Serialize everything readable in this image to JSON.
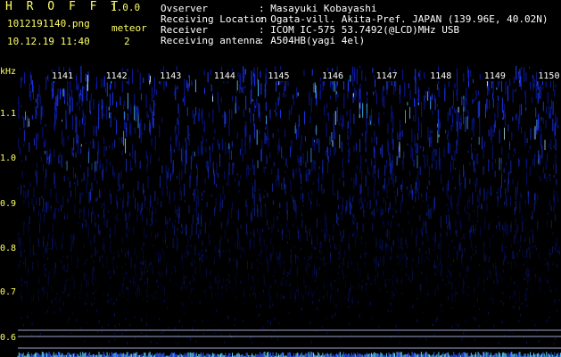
{
  "app": {
    "title": "H R O F F T",
    "version": "1.0.0"
  },
  "file": {
    "name": "1012191140.png",
    "datetime": "10.12.19 11:40"
  },
  "meteor": {
    "label": "meteor",
    "count": "2"
  },
  "info": {
    "observer": {
      "key": "Ovserver",
      "value": ": Masayuki Kobayashi"
    },
    "location": {
      "key": "Receiving Location",
      "value": ": Ogata-vill. Akita-Pref. JAPAN (139.96E, 40.02N)"
    },
    "receiver": {
      "key": "Receiver",
      "value": ": ICOM IC-575 53.7492(@LCD)MHz USB"
    },
    "antenna": {
      "key": "Receiving antenna",
      "value": ": A504HB(yagi 4el)"
    }
  },
  "axis": {
    "unit": "kHz",
    "yticks": [
      "1.1",
      "1.0",
      "0.9",
      "0.8",
      "0.7",
      "0.6"
    ],
    "xticks": [
      "1141",
      "1142",
      "1143",
      "1144",
      "1145",
      "1146",
      "1147",
      "1148",
      "1149",
      "1150"
    ]
  },
  "colors": {
    "label": "#ffff66",
    "info": "#ffffff",
    "signal": "#2a4dff",
    "bright": "#7fd8ff"
  }
}
